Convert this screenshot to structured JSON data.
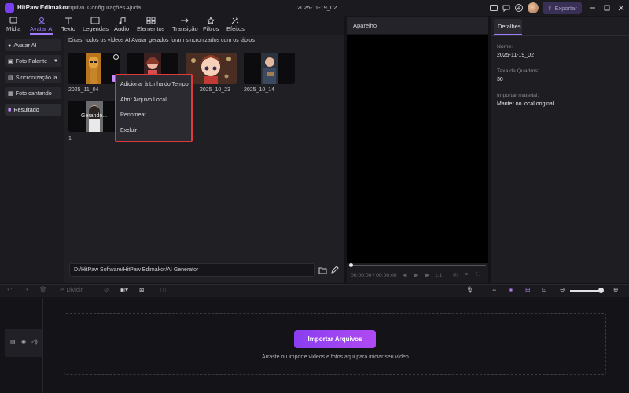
{
  "window": {
    "app_title": "HitPaw Edimakor",
    "project_title": "2025-11-19_02"
  },
  "menu": [
    "Arquivo",
    "Configurações",
    "Ajuda"
  ],
  "header": {
    "export_label": "Exportar"
  },
  "toolbar": {
    "tabs": [
      {
        "label": "Mídia",
        "icon": "media-icon"
      },
      {
        "label": "Avatar AI",
        "icon": "avatar-ai-icon"
      },
      {
        "label": "Texto",
        "icon": "text-icon"
      },
      {
        "label": "Legendas",
        "icon": "captions-icon"
      },
      {
        "label": "Áudio",
        "icon": "audio-icon"
      },
      {
        "label": "Elementos",
        "icon": "elements-icon"
      },
      {
        "label": "Transição",
        "icon": "transition-icon"
      },
      {
        "label": "Filtros",
        "icon": "filters-icon"
      },
      {
        "label": "Efeitos",
        "icon": "effects-icon"
      }
    ],
    "active": "Avatar AI"
  },
  "sidebar": {
    "items": [
      {
        "label": "Avatar AI"
      },
      {
        "label": "Foto Falante"
      },
      {
        "label": "Sincronização la..."
      },
      {
        "label": "Foto cantando"
      },
      {
        "label": "Resultado"
      }
    ]
  },
  "media": {
    "tip": "Dicas: todos os vídeos AI Avatar gerados foram sincronizados com os lábios",
    "items": [
      {
        "label": "2025_11_04"
      },
      {
        "label": ""
      },
      {
        "label": "2025_10_23"
      },
      {
        "label": "2025_10_14"
      },
      {
        "label": "1",
        "overlay": "Gerando..."
      }
    ],
    "path": "D:/HitPaw Software/HitPaw Edimakor/AI Generator"
  },
  "context_menu": {
    "items": [
      "Adicionar à Linha do Tempo",
      "Abrir Arquivo Local",
      "Renomear",
      "Excluir"
    ]
  },
  "player": {
    "title": "Aparelho",
    "timecode": "00:00:00 / 00:00:00",
    "speed": "1:1"
  },
  "details": {
    "tab": "Detalhes",
    "fields": [
      {
        "label": "Nome:",
        "value": "2025-11-19_02"
      },
      {
        "label": "Taxa de Quadros:",
        "value": "30"
      },
      {
        "label": "Importar material:",
        "value": "Manter no local original"
      }
    ]
  },
  "timeline": {
    "divide_label": "Dividir",
    "import_button": "Importar Arquivos",
    "drop_hint": "Arraste ou importe vídeos e fotos aqui para iniciar seu vídeo."
  },
  "colors": {
    "accent": "#9f7bff",
    "highlight": "#e0393c",
    "import_gradient": "#8a3ef0"
  }
}
